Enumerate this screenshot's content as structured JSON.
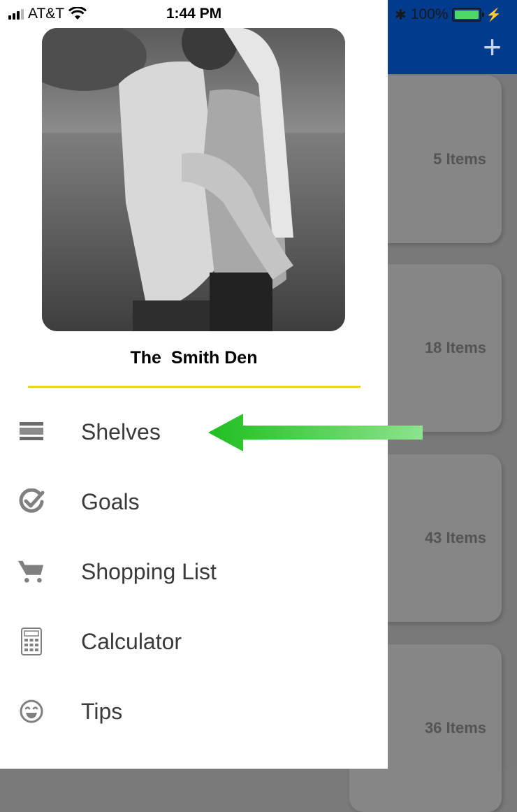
{
  "status_bar": {
    "carrier": "AT&T",
    "time": "1:44 PM",
    "battery": "100%"
  },
  "header": {
    "add_icon": "plus-icon"
  },
  "shelves": [
    {
      "count": "5 Items"
    },
    {
      "count": "18 Items"
    },
    {
      "count": "43 Items"
    },
    {
      "count": "36 Items"
    }
  ],
  "drawer": {
    "home_name": "The  Smith Den",
    "menu": [
      {
        "label": "Shelves",
        "icon": "shelves-icon"
      },
      {
        "label": "Goals",
        "icon": "goals-check-icon"
      },
      {
        "label": "Shopping List",
        "icon": "shopping-cart-icon"
      },
      {
        "label": "Calculator",
        "icon": "calculator-icon"
      },
      {
        "label": "Tips",
        "icon": "smiley-icon"
      }
    ]
  },
  "colors": {
    "header_blue": "#003b8e",
    "divider_yellow": "#ecd320",
    "arrow_green": "#2ec52e"
  }
}
